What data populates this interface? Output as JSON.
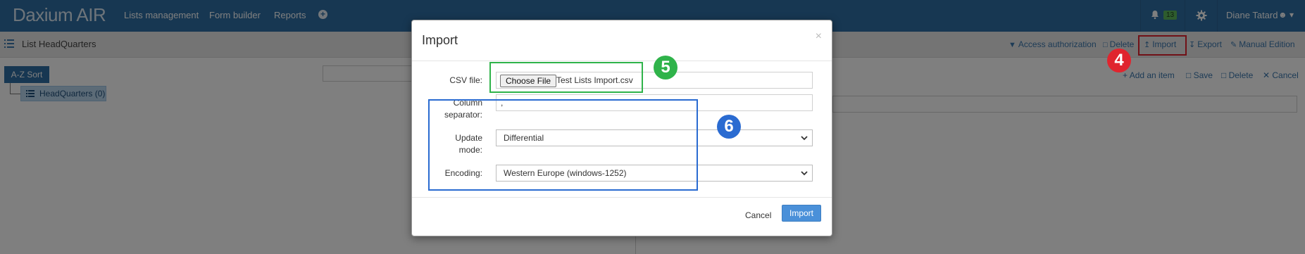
{
  "navbar": {
    "brand": "Daxium AIR",
    "links": [
      "Lists management",
      "Form builder",
      "Reports"
    ],
    "notification_count": "13",
    "user_name": "Diane Tatard"
  },
  "toolbar": {
    "list_title": "List HeadQuarters",
    "actions": {
      "access_authorization": "Access authorization",
      "delete": "Delete",
      "import": "Import",
      "export": "Export",
      "manual_edition": "Manual Edition"
    }
  },
  "tree": {
    "sort_label": "A-Z Sort",
    "item_label": "HeadQuarters (0)"
  },
  "item_actions": {
    "add_item": "Add an item",
    "save": "Save",
    "delete": "Delete",
    "cancel": "Cancel"
  },
  "modal": {
    "title": "Import",
    "close": "×",
    "csv_label": "CSV file:",
    "choose_file": "Choose File",
    "file_name": "Test Lists Import.csv",
    "separator_label_1": "Column",
    "separator_label_2": "separator:",
    "separator_value": ",",
    "update_mode_label_1": "Update",
    "update_mode_label_2": "mode:",
    "update_mode_value": "Differential",
    "encoding_label": "Encoding:",
    "encoding_value": "Western Europe (windows-1252)",
    "cancel": "Cancel",
    "import": "Import"
  },
  "annotations": {
    "step_4": "4",
    "step_5": "5",
    "step_6": "6"
  },
  "colors": {
    "navbar": "#2f6fa5",
    "highlight_red": "#e2202c",
    "highlight_green": "#2fb34a",
    "highlight_blue": "#2a6bd1",
    "primary_button": "#4a90d9"
  }
}
